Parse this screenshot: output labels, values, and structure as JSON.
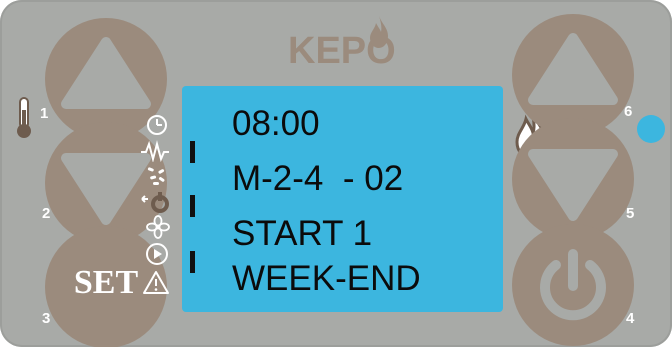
{
  "brand": {
    "logo_text": "KEPO"
  },
  "display": {
    "lines": [
      "08:00",
      "M-2-4  - 02",
      "START 1",
      "WEEK-END"
    ],
    "background_color": "#3cb6df",
    "text_color": "#0b0b0b"
  },
  "buttons": {
    "up_left": {
      "number": "1",
      "icon": "triangle-up-icon"
    },
    "down_left": {
      "number": "2",
      "icon": "triangle-down-icon"
    },
    "set": {
      "number": "3",
      "label": "SET"
    },
    "power": {
      "number": "4",
      "icon": "power-icon"
    },
    "down_right": {
      "number": "5",
      "icon": "triangle-down-icon"
    },
    "up_right": {
      "number": "6",
      "icon": "triangle-up-icon"
    }
  },
  "status_icons": [
    "clock-icon",
    "heat-wave-icon",
    "pellet-icon",
    "fan-icon",
    "motor-icon",
    "play-icon",
    "warning-icon"
  ],
  "indicator": {
    "color": "#3cb6df"
  },
  "colors": {
    "panel": "#a8aaa7",
    "button": "#9b8b7d",
    "button_symbol": "#a8aaa7"
  }
}
